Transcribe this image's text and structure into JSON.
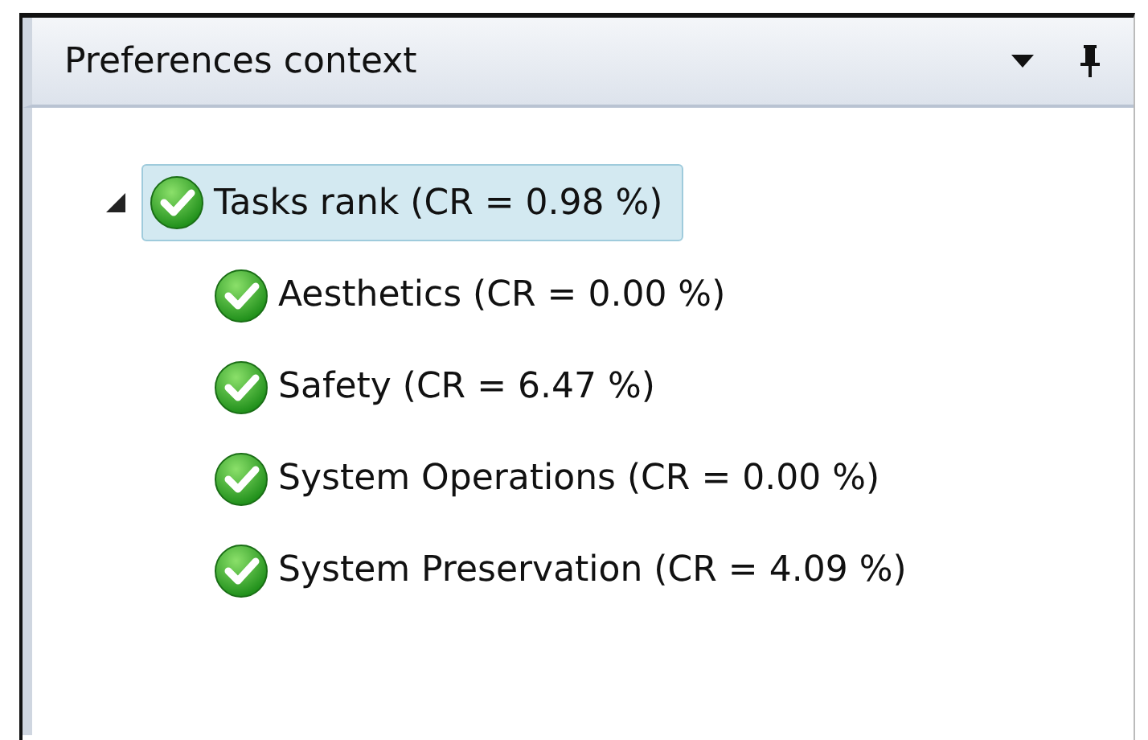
{
  "panel": {
    "title": "Preferences context"
  },
  "tree": [
    {
      "label": "Tasks rank (CR = 0.98 %)",
      "selected": true,
      "expanded": true,
      "children": [
        {
          "label": "Aesthetics (CR = 0.00 %)",
          "selected": false
        },
        {
          "label": "Safety (CR = 6.47 %)",
          "selected": false
        },
        {
          "label": "System Operations (CR = 0.00 %)",
          "selected": false
        },
        {
          "label": "System Preservation (CR = 4.09 %)",
          "selected": false
        }
      ]
    }
  ]
}
